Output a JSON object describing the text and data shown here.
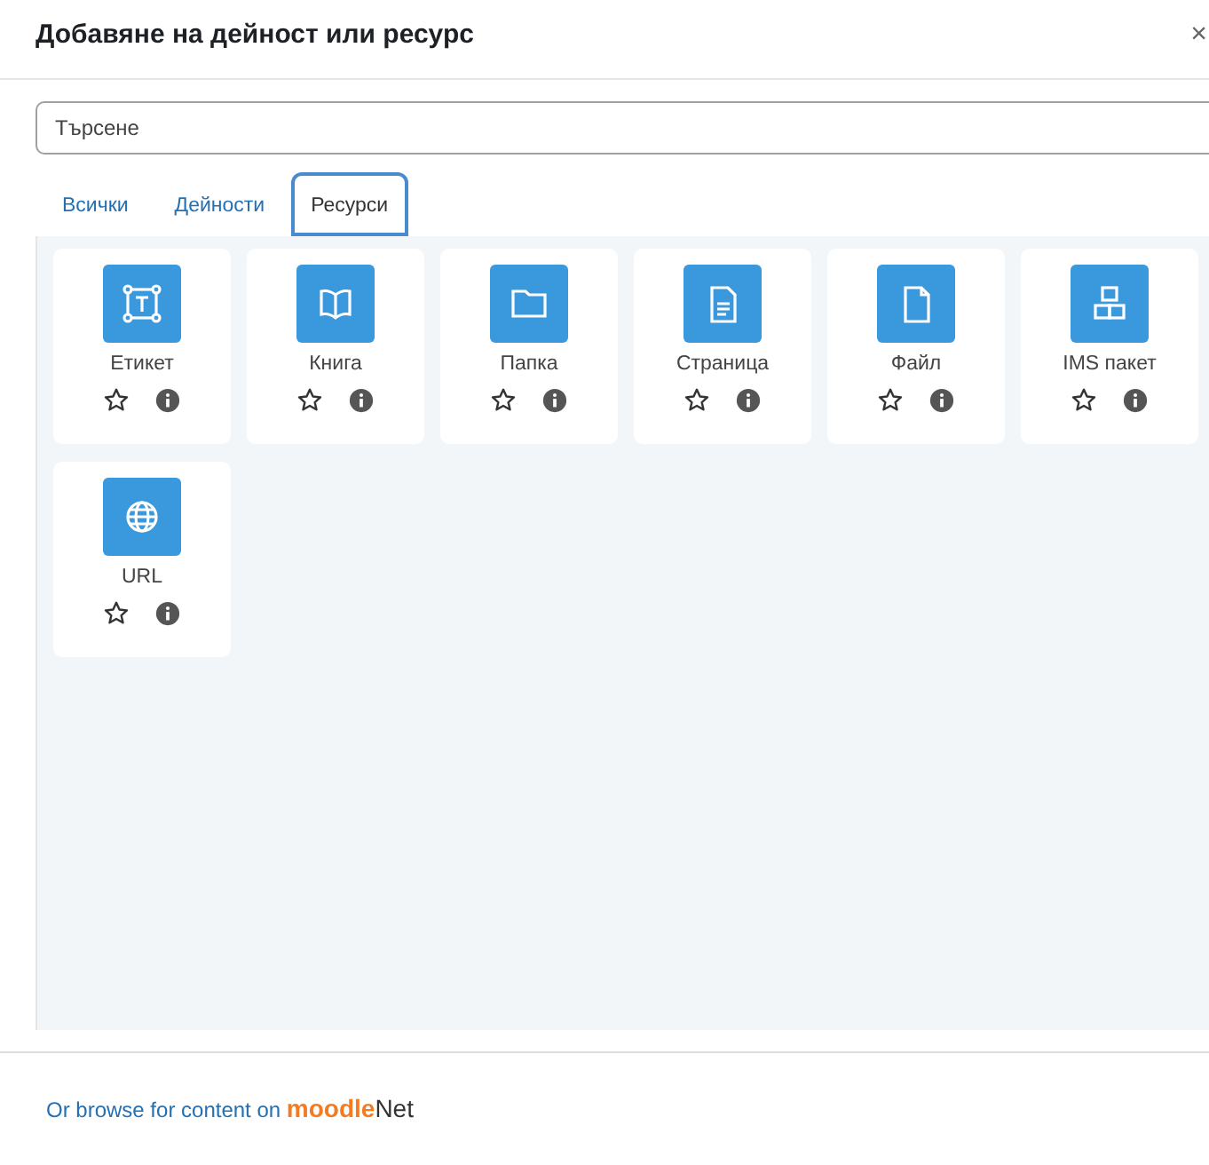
{
  "window": {
    "title": "Добавяне на дейност или ресурс",
    "close": "×"
  },
  "search": {
    "placeholder": "Търсене"
  },
  "tabs": [
    {
      "label": "Всички",
      "selected": false
    },
    {
      "label": "Дейности",
      "selected": false
    },
    {
      "label": "Ресурси",
      "selected": true
    }
  ],
  "items": [
    {
      "name": "Етикет",
      "kind": "label",
      "starred": false
    },
    {
      "name": "Книга",
      "kind": "book",
      "starred": false
    },
    {
      "name": "Папка",
      "kind": "folder",
      "starred": false
    },
    {
      "name": "Страница",
      "kind": "page",
      "starred": false
    },
    {
      "name": "Файл",
      "kind": "file",
      "starred": false
    },
    {
      "name": "IMS пакет",
      "kind": "package",
      "starred": false
    },
    {
      "name": "URL",
      "kind": "url",
      "starred": false
    }
  ],
  "footer": {
    "link": "Or browse for content on",
    "logo_main": "moodle",
    "logo_suffix": "Net"
  }
}
